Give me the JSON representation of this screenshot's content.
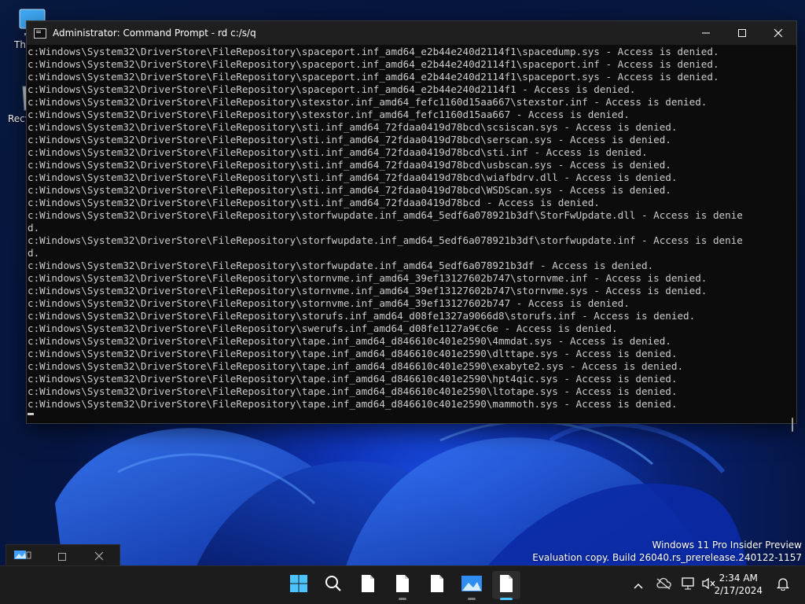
{
  "desktop": {
    "icons": [
      {
        "label": "Thi"
      },
      {
        "label": "Recy"
      }
    ],
    "watermark": {
      "line1": "Windows 11 Pro Insider Preview",
      "line2": "Evaluation copy. Build 26040.rs_prerelease.240122-1157"
    }
  },
  "console_window": {
    "title": "Administrator: Command Prompt - rd  c:/s/q",
    "lines": [
      "c:Windows\\System32\\DriverStore\\FileRepository\\spaceport.inf_amd64_e2b44e240d2114f1\\spacedump.sys - Access is denied.",
      "c:Windows\\System32\\DriverStore\\FileRepository\\spaceport.inf_amd64_e2b44e240d2114f1\\spaceport.inf - Access is denied.",
      "c:Windows\\System32\\DriverStore\\FileRepository\\spaceport.inf_amd64_e2b44e240d2114f1\\spaceport.sys - Access is denied.",
      "c:Windows\\System32\\DriverStore\\FileRepository\\spaceport.inf_amd64_e2b44e240d2114f1 - Access is denied.",
      "c:Windows\\System32\\DriverStore\\FileRepository\\stexstor.inf_amd64_fefc1160d15aa667\\stexstor.inf - Access is denied.",
      "c:Windows\\System32\\DriverStore\\FileRepository\\stexstor.inf_amd64_fefc1160d15aa667 - Access is denied.",
      "c:Windows\\System32\\DriverStore\\FileRepository\\sti.inf_amd64_72fdaa0419d78bcd\\scsiscan.sys - Access is denied.",
      "c:Windows\\System32\\DriverStore\\FileRepository\\sti.inf_amd64_72fdaa0419d78bcd\\serscan.sys - Access is denied.",
      "c:Windows\\System32\\DriverStore\\FileRepository\\sti.inf_amd64_72fdaa0419d78bcd\\sti.inf - Access is denied.",
      "c:Windows\\System32\\DriverStore\\FileRepository\\sti.inf_amd64_72fdaa0419d78bcd\\usbscan.sys - Access is denied.",
      "c:Windows\\System32\\DriverStore\\FileRepository\\sti.inf_amd64_72fdaa0419d78bcd\\wiafbdrv.dll - Access is denied.",
      "c:Windows\\System32\\DriverStore\\FileRepository\\sti.inf_amd64_72fdaa0419d78bcd\\WSDScan.sys - Access is denied.",
      "c:Windows\\System32\\DriverStore\\FileRepository\\sti.inf_amd64_72fdaa0419d78bcd - Access is denied.",
      "c:Windows\\System32\\DriverStore\\FileRepository\\storfwupdate.inf_amd64_5edf6a078921b3df\\StorFwUpdate.dll - Access is denie",
      "d.",
      "c:Windows\\System32\\DriverStore\\FileRepository\\storfwupdate.inf_amd64_5edf6a078921b3df\\storfwupdate.inf - Access is denie",
      "d.",
      "c:Windows\\System32\\DriverStore\\FileRepository\\storfwupdate.inf_amd64_5edf6a078921b3df - Access is denied.",
      "c:Windows\\System32\\DriverStore\\FileRepository\\stornvme.inf_amd64_39ef13127602b747\\stornvme.inf - Access is denied.",
      "c:Windows\\System32\\DriverStore\\FileRepository\\stornvme.inf_amd64_39ef13127602b747\\stornvme.sys - Access is denied.",
      "c:Windows\\System32\\DriverStore\\FileRepository\\stornvme.inf_amd64_39ef13127602b747 - Access is denied.",
      "c:Windows\\System32\\DriverStore\\FileRepository\\storufs.inf_amd64_d08fe1327a9066d8\\storufs.inf - Access is denied.",
      "c:Windows\\System32\\DriverStore\\FileRepository\\swerufs.inf_amd64_d08fe1127a9€c6e - Access is denied.",
      "c:Windows\\System32\\DriverStore\\FileRepository\\tape.inf_amd64_d846610c401e2590\\4mmdat.sys - Access is denied.",
      "c:Windows\\System32\\DriverStore\\FileRepository\\tape.inf_amd64_d846610c401e2590\\dlttape.sys - Access is denied.",
      "c:Windows\\System32\\DriverStore\\FileRepository\\tape.inf_amd64_d846610c401e2590\\exabyte2.sys - Access is denied.",
      "c:Windows\\System32\\DriverStore\\FileRepository\\tape.inf_amd64_d846610c401e2590\\hpt4qic.sys - Access is denied.",
      "c:Windows\\System32\\DriverStore\\FileRepository\\tape.inf_amd64_d846610c401e2590\\ltotape.sys - Access is denied.",
      "c:Windows\\System32\\DriverStore\\FileRepository\\tape.inf_amd64_d846610c401e2590\\mammoth.sys - Access is denied."
    ],
    "controls": {
      "minimize": "minimize-icon",
      "maximize": "maximize-icon",
      "close": "close-icon"
    }
  },
  "taskbar": {
    "items": [
      {
        "name": "start",
        "icon": "windows-logo-icon"
      },
      {
        "name": "search",
        "icon": "search-icon"
      },
      {
        "name": "file-1",
        "icon": "document-icon"
      },
      {
        "name": "file-2",
        "icon": "document-icon"
      },
      {
        "name": "file-3",
        "icon": "document-icon"
      },
      {
        "name": "photo",
        "icon": "image-icon"
      },
      {
        "name": "file-4",
        "icon": "document-icon",
        "active": true
      }
    ],
    "tray": {
      "icons": [
        "chevron-up-icon",
        "cloud-off-icon",
        "network-icon",
        "volume-muted-icon"
      ],
      "time": "2:34 AM",
      "date": "2/17/2024"
    }
  },
  "colors": {
    "console_bg": "#0c0c0c",
    "console_text": "#cccccc",
    "taskbar_bg": "#1c1c1c",
    "accent": "#4cc2ff"
  }
}
